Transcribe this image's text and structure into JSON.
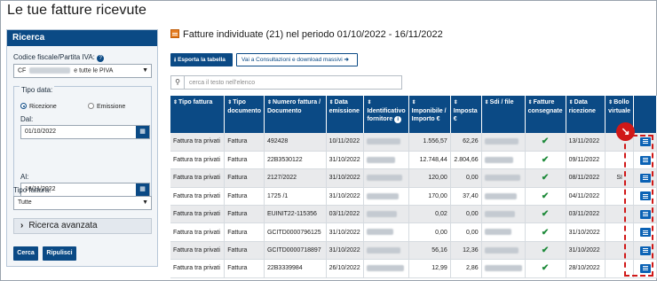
{
  "page": {
    "title": "Le tue fatture ricevute"
  },
  "ricerca": {
    "header": "Ricerca",
    "cf_label": "Codice fiscale/Partita IVA:",
    "help_icon": "?",
    "cf_prefix": "CF",
    "cf_suffix": "e tutte le PIVA",
    "tipo_data_label": "Tipo data:",
    "radio_ricezione": "Ricezione",
    "radio_emissione": "Emissione",
    "dal_label": "Dal:",
    "dal_value": "01/10/2022",
    "al_label": "Al:",
    "al_value": "16/11/2022",
    "tipo_fattura_label": "Tipo fattura:",
    "tipo_fattura_value": "Tutte",
    "ricerca_avanzata": "Ricerca avanzata",
    "cerca": "Cerca",
    "ripulisci": "Ripulisci"
  },
  "results": {
    "title": "Fatture individuate (21) nel periodo 01/10/2022 - 16/11/2022",
    "export_label": "Esporta la tabella",
    "consult_label": "Vai a Consultazioni e download massivi",
    "search_placeholder": "cerca il testo nell'elenco",
    "columns": [
      "Tipo fattura",
      "Tipo documento",
      "Numero fattura / Documento",
      "Data emissione",
      "Identificativo fornitore",
      "Imponibile / Importo €",
      "Imposta €",
      "Sdi / file",
      "Fatture consegnate",
      "Data ricezione",
      "Bollo virtuale"
    ],
    "rows": [
      {
        "tipo": "Fattura tra privati",
        "doc": "Fattura",
        "numero": "492428",
        "data_em": "10/11/2022",
        "imponibile": "1.556,57",
        "imposta": "62,26",
        "ricezione": "13/11/2022",
        "bollo": ""
      },
      {
        "tipo": "Fattura tra privati",
        "doc": "Fattura",
        "numero": "22B3530122",
        "data_em": "31/10/2022",
        "imponibile": "12.748,44",
        "imposta": "2.804,66",
        "ricezione": "09/11/2022",
        "bollo": ""
      },
      {
        "tipo": "Fattura tra privati",
        "doc": "Fattura",
        "numero": "2127/2022",
        "data_em": "31/10/2022",
        "imponibile": "120,00",
        "imposta": "0,00",
        "ricezione": "08/11/2022",
        "bollo": "SI"
      },
      {
        "tipo": "Fattura tra privati",
        "doc": "Fattura",
        "numero": "1725 /1",
        "data_em": "31/10/2022",
        "imponibile": "170,00",
        "imposta": "37,40",
        "ricezione": "04/11/2022",
        "bollo": ""
      },
      {
        "tipo": "Fattura tra privati",
        "doc": "Fattura",
        "numero": "EUINIT22-115356",
        "data_em": "03/11/2022",
        "imponibile": "0,02",
        "imposta": "0,00",
        "ricezione": "03/11/2022",
        "bollo": ""
      },
      {
        "tipo": "Fattura tra privati",
        "doc": "Fattura",
        "numero": "GCITD0000796125",
        "data_em": "31/10/2022",
        "imponibile": "0,00",
        "imposta": "0,00",
        "ricezione": "31/10/2022",
        "bollo": ""
      },
      {
        "tipo": "Fattura tra privati",
        "doc": "Fattura",
        "numero": "GCITD0000718897",
        "data_em": "31/10/2022",
        "imponibile": "56,16",
        "imposta": "12,36",
        "ricezione": "31/10/2022",
        "bollo": ""
      },
      {
        "tipo": "Fattura tra privati",
        "doc": "Fattura",
        "numero": "22B3339984",
        "data_em": "26/10/2022",
        "imponibile": "12,99",
        "imposta": "2,86",
        "ricezione": "28/10/2022",
        "bollo": ""
      }
    ],
    "callout_icon": "↘"
  },
  "colors": {
    "brand": "#0b4a85",
    "highlight": "#d01818",
    "check": "#1e8a3a"
  }
}
